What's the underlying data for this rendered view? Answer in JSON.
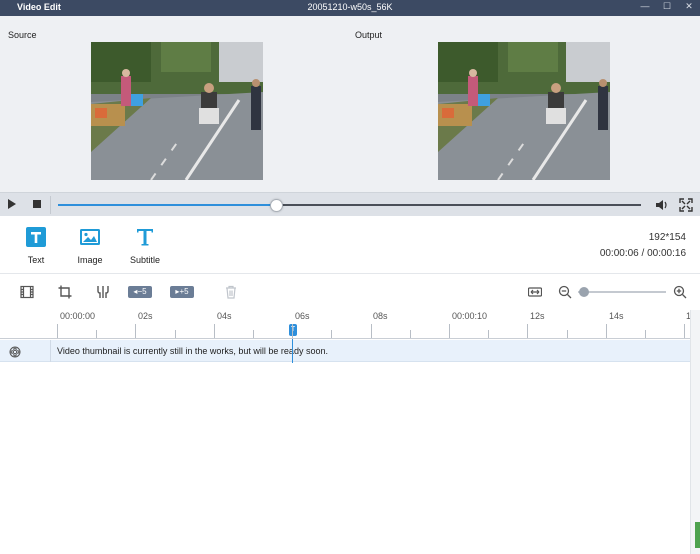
{
  "window": {
    "app_title": "Video Edit",
    "file_title": "20051210-w50s_56K",
    "controls": {
      "minimize": "—",
      "maximize": "☐",
      "close": "✕"
    }
  },
  "preview": {
    "source_label": "Source",
    "output_label": "Output"
  },
  "playback": {
    "progress": 0.376,
    "icons": [
      "play-icon",
      "stop-icon",
      "volume-icon",
      "fullscreen-icon"
    ]
  },
  "tools": {
    "items": [
      {
        "label": "Text",
        "icon": "text-icon"
      },
      {
        "label": "Image",
        "icon": "image-icon"
      },
      {
        "label": "Subtitle",
        "icon": "subtitle-icon"
      }
    ],
    "resolution": "192*154",
    "timecode": "00:00:06 / 00:00:16"
  },
  "edit_toolbar": {
    "back5_label": "◂−5",
    "fwd5_label": "▸+5",
    "zoom_level": 0.05,
    "icons": [
      "film-icon",
      "crop-icon",
      "split-icon",
      "back-5-icon",
      "forward-5-icon",
      "trash-icon",
      "fit-width-icon",
      "zoom-out-icon",
      "zoom-in-icon"
    ]
  },
  "timeline": {
    "labels": [
      "00:00:00",
      "02s",
      "04s",
      "06s",
      "08s",
      "00:00:10",
      "12s",
      "14s",
      "1"
    ],
    "playhead_label": "T",
    "track_message": "Video thumbnail is currently still in the works, but will be ready soon."
  },
  "colors": {
    "titlebar": "#3c4a63",
    "accent": "#2e8fdb",
    "tool_icon": "#1f9bd7"
  }
}
